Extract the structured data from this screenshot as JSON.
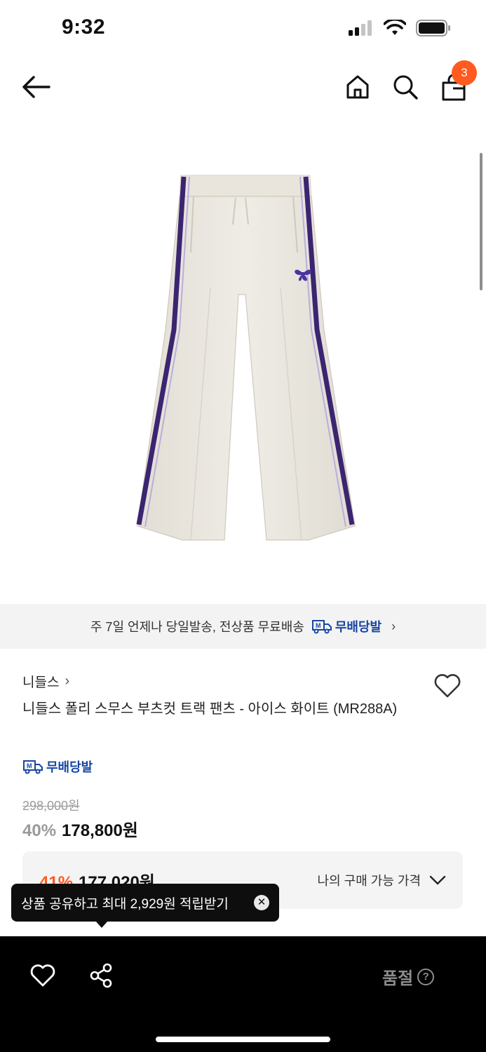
{
  "status_bar": {
    "time": "9:32",
    "icons": [
      "signal-icon",
      "wifi-icon",
      "battery-icon"
    ]
  },
  "header": {
    "icons": [
      "back-arrow-icon",
      "home-icon",
      "search-icon",
      "shopping-bag-icon"
    ],
    "cart_count": "3",
    "badge_color": "#ff5a1f"
  },
  "product_image": {
    "icon": "track-pants-image",
    "colors": {
      "body": "#ece9e2",
      "stripe": "#3b2470"
    }
  },
  "shipping_banner": {
    "text": "주 7일 언제나 당일발송, 전상품 무료배송",
    "badge_label": "무배당발",
    "badge_icon": "delivery-truck-icon",
    "chevron": "›"
  },
  "product": {
    "brand": "니들스",
    "brand_chevron": "›",
    "name": "니들스 폴리 스무스 부츠컷 트랙 팬츠 - 아이스 화이트 (MR288A)",
    "free_shipping_badge": "무배당발",
    "original_price": "298,000원",
    "discount": "40%",
    "sale_price": "178,800원"
  },
  "my_price": {
    "discount": "41%",
    "amount": "177,020원",
    "label": "나의 구매 가능 가격"
  },
  "tooltip": {
    "text": "상품 공유하고 최대 2,929원 적립받기",
    "close": "✕"
  },
  "bottom_bar": {
    "soldout_label": "품절",
    "help": "?"
  }
}
